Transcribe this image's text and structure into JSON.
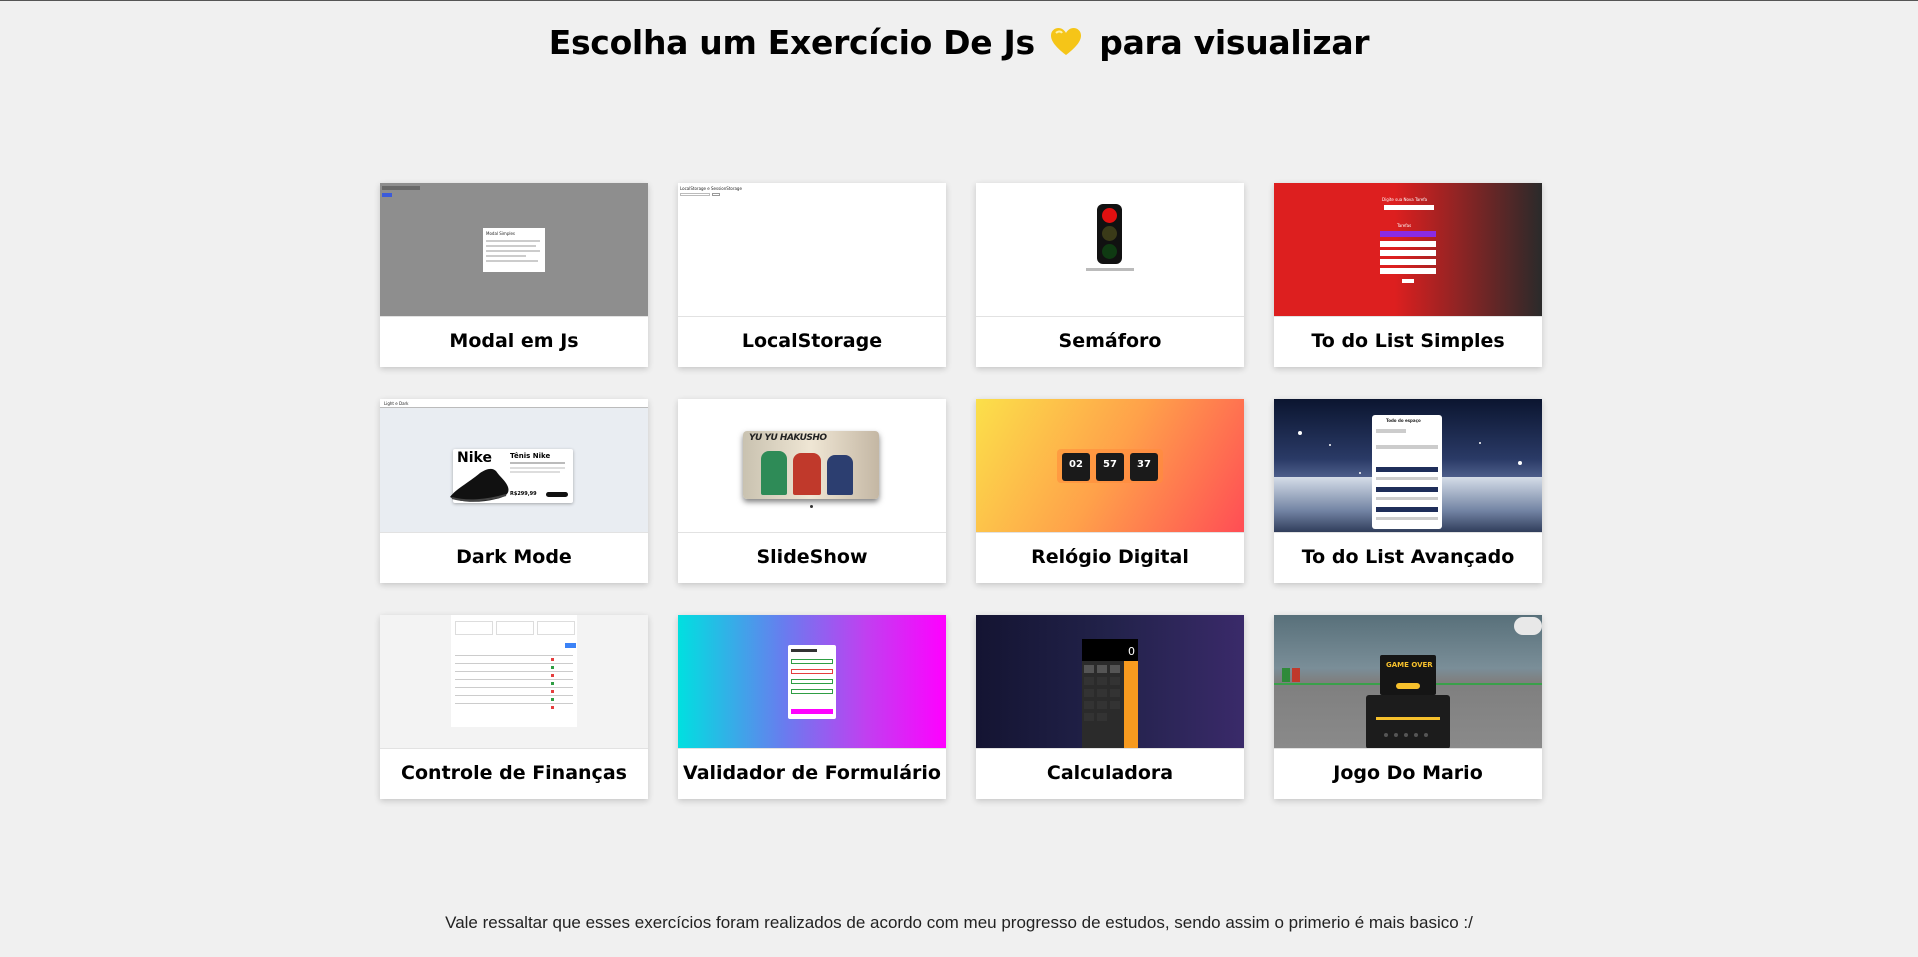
{
  "header": {
    "title_before": "Escolha um Exercício De Js",
    "heart_icon": "yellow-heart-icon",
    "title_after": "para visualizar"
  },
  "cards": [
    {
      "title": "Modal em Js",
      "thumb_small_text": "Modal Simples"
    },
    {
      "title": "LocalStorage",
      "thumb_small_text": "LocalStorage e SessionStorage"
    },
    {
      "title": "Semáforo"
    },
    {
      "title": "To do List Simples",
      "thumb_small_text": "Digite sua Nova Tarefa",
      "thumb_small_text_2": "Tarefas"
    },
    {
      "title": "Dark Mode",
      "thumb_brand": "Nike",
      "thumb_product": "Tênis Nike",
      "thumb_price": "R$299,99",
      "thumb_small_text": "Light e Dark"
    },
    {
      "title": "SlideShow",
      "thumb_banner": "YU YU HAKUSHO"
    },
    {
      "title": "Relógio Digital",
      "clock": [
        "02",
        "57",
        "37"
      ]
    },
    {
      "title": "To do List Avançado",
      "thumb_small_text": "Todo do espaço"
    },
    {
      "title": "Controle de Finanças"
    },
    {
      "title": "Validador de Formulário"
    },
    {
      "title": "Calculadora",
      "display": "0"
    },
    {
      "title": "Jogo Do Mario",
      "thumb_logo": "GAME OVER"
    }
  ],
  "footer": {
    "note": "Vale ressaltar que esses exercícios foram realizados de acordo com meu progresso de estudos, sendo assim o primerio é mais basico :/"
  },
  "colors": {
    "background": "#f0f0f0",
    "heart": "#f5c518",
    "to_do_gradient": [
      "#dd1f1f",
      "#2a2a2a"
    ],
    "clock_gradient": [
      "#fbe04a",
      "#ff5e5e"
    ],
    "validator_gradient": [
      "#00e0e0",
      "#ff00ff"
    ],
    "calc_gradient": [
      "#141432",
      "#3a2a6a"
    ]
  }
}
